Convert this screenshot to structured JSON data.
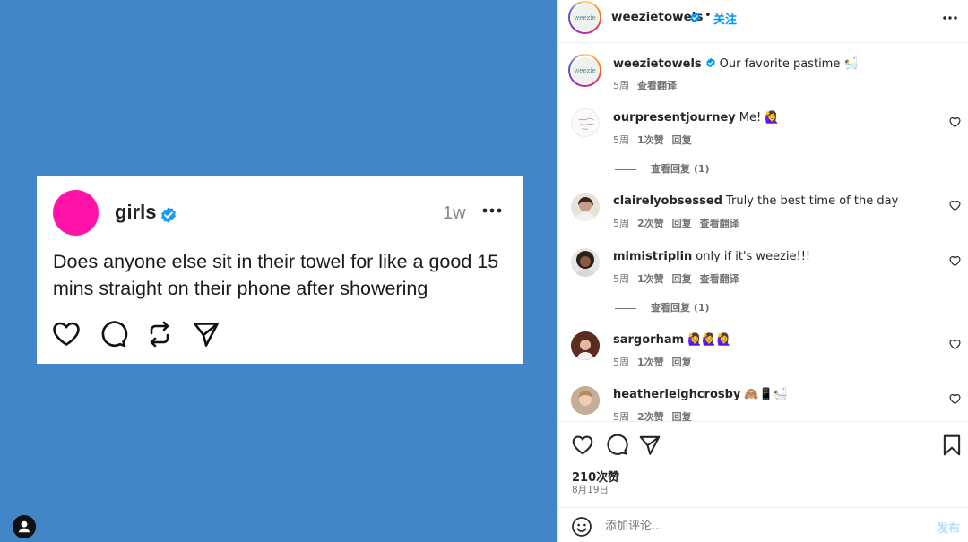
{
  "media": {
    "card": {
      "name": "girls",
      "time": "1w",
      "text": "Does anyone else sit in their towel for like a good 15 mins straight on their phone after showering",
      "avatar_color": "#ff12a8"
    },
    "background_color": "#4286c7",
    "icons": [
      "heart-icon",
      "comment-icon",
      "repost-icon",
      "share-icon"
    ]
  },
  "header": {
    "avatar_text": "weezie",
    "username": "weezietowels",
    "dot": "•",
    "follow_label": "关注"
  },
  "caption": {
    "avatar_text": "weezie",
    "username": "weezietowels",
    "text": "Our favorite pastime",
    "emoji": "🛀",
    "time": "5周",
    "translate": "查看翻译"
  },
  "comments": [
    {
      "username": "ourpresentjourney",
      "text": "Me! 🙋‍♀️",
      "time": "5周",
      "likes": "1次赞",
      "reply": "回复",
      "translate": "",
      "view_replies": "查看回复 (1)"
    },
    {
      "username": "clairelyobsessed",
      "text": "Truly the best time of the day",
      "time": "5周",
      "likes": "2次赞",
      "reply": "回复",
      "translate": "查看翻译",
      "view_replies": ""
    },
    {
      "username": "mimistriplin",
      "text": "only if it's weezie!!!",
      "time": "5周",
      "likes": "1次赞",
      "reply": "回复",
      "translate": "查看翻译",
      "view_replies": "查看回复 (1)"
    },
    {
      "username": "sargorham",
      "text": "🙋‍♀️🙋‍♀️🙋‍♀️",
      "time": "5周",
      "likes": "1次赞",
      "reply": "回复",
      "translate": "",
      "view_replies": ""
    },
    {
      "username": "heatherleighcrosby",
      "text": "🙈📱🛀",
      "time": "5周",
      "likes": "2次赞",
      "reply": "回复",
      "translate": "",
      "view_replies": ""
    }
  ],
  "actions": {
    "likes": "210次赞",
    "date": "8月19日"
  },
  "composer": {
    "placeholder": "添加评论...",
    "post_label": "发布"
  },
  "colors": {
    "accent": "#0095f6",
    "verified": "#0095f6",
    "post_disabled": "#b2dffc"
  }
}
